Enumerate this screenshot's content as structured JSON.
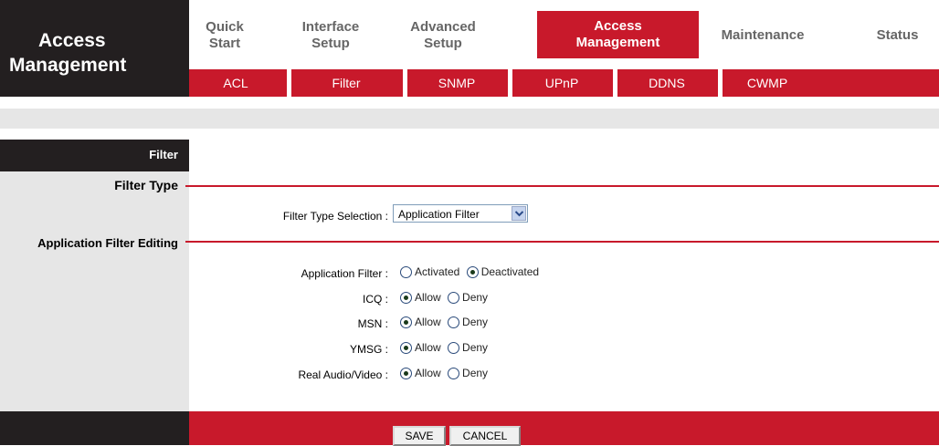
{
  "brand": {
    "line1": "Access",
    "line2": "Management"
  },
  "top_tabs": [
    {
      "line1": "Quick",
      "line2": "Start",
      "active": false
    },
    {
      "line1": "Interface",
      "line2": "Setup",
      "active": false
    },
    {
      "line1": "Advanced",
      "line2": "Setup",
      "active": false
    },
    {
      "line1": "Access",
      "line2": "Management",
      "active": true
    },
    {
      "line1": "Maintenance",
      "line2": "",
      "active": false
    },
    {
      "line1": "Status",
      "line2": "",
      "active": false
    }
  ],
  "sub_tabs": [
    "ACL",
    "Filter",
    "SNMP",
    "UPnP",
    "DDNS",
    "CWMP"
  ],
  "section": {
    "filter": "Filter",
    "filter_type": "Filter Type",
    "app_filter_editing": "Application Filter Editing"
  },
  "filter_type_selection": {
    "label": "Filter Type Selection :",
    "value": "Application Filter"
  },
  "application_filter": {
    "label": "Application Filter :",
    "options": [
      "Activated",
      "Deactivated"
    ],
    "selected": "Deactivated"
  },
  "apps": [
    {
      "label": "ICQ :",
      "allow": "Allow",
      "deny": "Deny",
      "selected": "Allow"
    },
    {
      "label": "MSN :",
      "allow": "Allow",
      "deny": "Deny",
      "selected": "Allow"
    },
    {
      "label": "YMSG :",
      "allow": "Allow",
      "deny": "Deny",
      "selected": "Allow"
    },
    {
      "label": "Real Audio/Video :",
      "allow": "Allow",
      "deny": "Deny",
      "selected": "Allow"
    }
  ],
  "buttons": {
    "save": "SAVE",
    "cancel": "CANCEL"
  },
  "colors": {
    "accent": "#c8192b",
    "dark": "#231f20",
    "panel": "#e6e6e6"
  }
}
